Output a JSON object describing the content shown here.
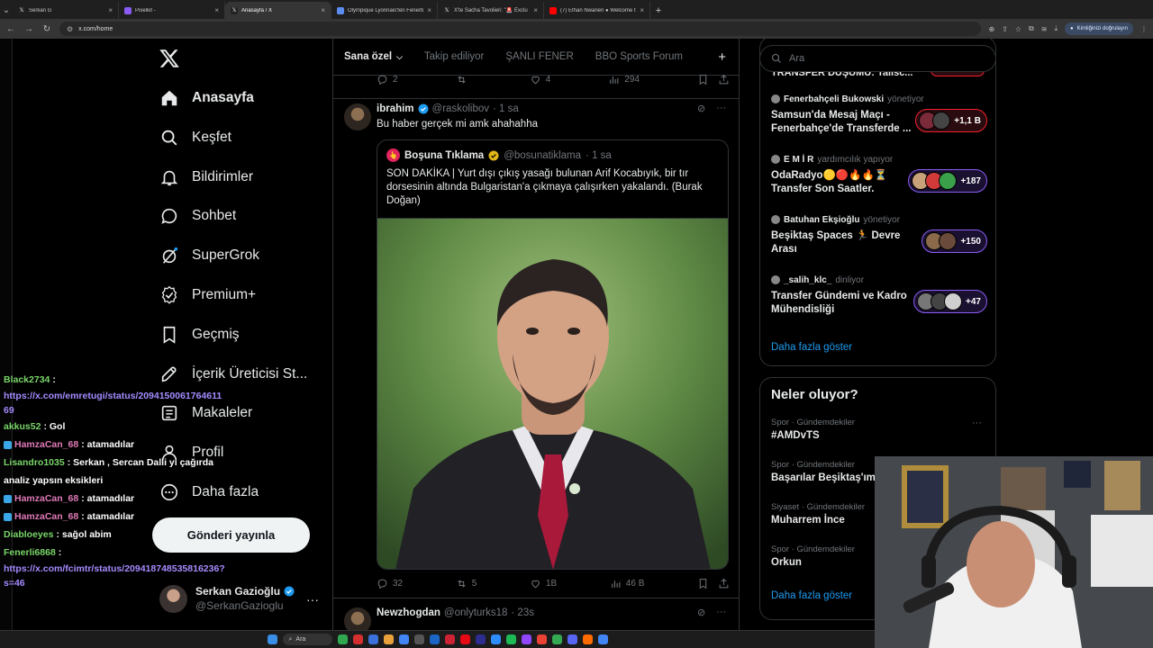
{
  "browser": {
    "tabs": [
      {
        "label": "Serkan G",
        "color": "#ffffff",
        "icon": "x-icon"
      },
      {
        "label": "Pixelkit -",
        "color": "#8a5cf5",
        "icon": "pixel-icon"
      },
      {
        "label": "Anasayfa / X",
        "color": "#ffffff",
        "icon": "x-icon",
        "active": true
      },
      {
        "label": "Olympique Lyonnais'ten Fenerb",
        "color": "#5b8def",
        "icon": "tf-icon"
      },
      {
        "label": "X'te Sacha Tavolieri: \"🚨 Exclu",
        "color": "#ffffff",
        "icon": "x-icon"
      },
      {
        "label": "(7) Ethan Nwaneri ● Welcome t",
        "color": "#ff0000",
        "icon": "youtube-icon"
      }
    ],
    "url": "x.com/home",
    "verify_label": "Kimliğinizi doğrulayın"
  },
  "sidebar": {
    "items": [
      {
        "label": "Anasayfa",
        "icon": "home-icon"
      },
      {
        "label": "Keşfet",
        "icon": "search-icon"
      },
      {
        "label": "Bildirimler",
        "icon": "bell-icon"
      },
      {
        "label": "Sohbet",
        "icon": "chat-icon"
      },
      {
        "label": "SuperGrok",
        "icon": "grok-icon"
      },
      {
        "label": "Premium+",
        "icon": "premium-icon"
      },
      {
        "label": "Geçmiş",
        "icon": "bookmark-icon"
      },
      {
        "label": "İçerik Üreticisi St...",
        "icon": "rocket-icon"
      },
      {
        "label": "Makaleler",
        "icon": "article-icon"
      },
      {
        "label": "Profil",
        "icon": "profile-icon"
      },
      {
        "label": "Daha fazla",
        "icon": "more-icon"
      }
    ],
    "post_button": "Gönderi yayınla",
    "account": {
      "name": "Serkan Gazioğlu",
      "handle": "@SerkanGazioglu"
    }
  },
  "timeline": {
    "tabs": [
      "Sana özel",
      "Takip ediliyor",
      "ŞANLI FENER",
      "BBO Sports Forum"
    ],
    "prev_stats": {
      "replies": "2",
      "reposts": "",
      "likes": "4",
      "views": "294"
    },
    "tweet": {
      "name": "ibrahim",
      "handle": "@raskolibov",
      "time": "· 1 sa",
      "text": "Bu haber gerçek mi amk ahahahha",
      "quote": {
        "name": "Boşuna Tıklama",
        "handle": "@bosunatiklama",
        "time": "· 1 sa",
        "text": "SON DAKİKA | Yurt dışı çıkış yasağı bulunan Arif Kocabıyık, bir tır dorsesinin altında Bulgaristan'a çıkmaya çalışırken yakalandı. (Burak Doğan)"
      },
      "stats": {
        "replies": "32",
        "reposts": "5",
        "likes": "1B",
        "views": "46 B"
      }
    },
    "next": {
      "name": "Newzhogdan",
      "handle": "@onlyturks18",
      "time": "· 23s"
    }
  },
  "right": {
    "search_placeholder": "Ara",
    "clipped_title": "TRANSFER DUŞUMU: Talısc...",
    "spaces": [
      {
        "host": "Fenerbahçeli Bukowski",
        "role": "yönetiyor",
        "title": "Samsun'da Mesaj Maçı - Fenerbahçe'de Transferde ...",
        "count": "+1,1 B",
        "style": "red"
      },
      {
        "host": "E M İ R",
        "role": "yardımcılık yapıyor",
        "title": "OdaRadyo🟡🔴🔥🔥⏳ Transfer Son Saatler.",
        "count": "+187",
        "style": "purple"
      },
      {
        "host": "Batuhan Ekşioğlu",
        "role": "yönetiyor",
        "title": "Beşiktaş Spaces 🏃 Devre Arası",
        "count": "+150",
        "style": "purple"
      },
      {
        "host": "_salih_klc_",
        "role": "dinliyor",
        "title": "Transfer Gündemi ve Kadro Mühendisliği",
        "count": "+47",
        "style": "purple"
      }
    ],
    "spaces_more": "Daha fazla göster",
    "trends_title": "Neler oluyor?",
    "trends": [
      {
        "category": "Spor · Gündemdekiler",
        "name": "#AMDvTS"
      },
      {
        "category": "Spor · Gündemdekiler",
        "name": "Başarılar Beşiktaş'ım"
      },
      {
        "category": "Siyaset · Gündemdekiler",
        "name": "Muharrem İnce"
      },
      {
        "category": "Spor · Gündemdekiler",
        "name": "Orkun"
      }
    ],
    "trends_more": "Daha fazla göster"
  },
  "chat": [
    {
      "user": "Black2734",
      "text": ":",
      "link": "https://x.com/emretugi/status/2094150061764​61​169"
    },
    {
      "user": "akkus52",
      "text": ": Gol"
    },
    {
      "user": "HamzaCan_68",
      "text": ": atamadılar",
      "badge": true
    },
    {
      "user": "Lisandro1035",
      "text": ": Serkan , Sercan Dalli yı çağırda analiz yapsın eksikleri"
    },
    {
      "user": "HamzaCan_68",
      "text": ": atamadılar",
      "badge": true
    },
    {
      "user": "HamzaCan_68",
      "text": ": atamadılar",
      "badge": true
    },
    {
      "user": "Diabloeyes",
      "text": ": sağol abim"
    },
    {
      "user": "Fenerli6868",
      "text": ":",
      "link": "https://x.com/fcimtr/status/20941874853581623​6?s=46"
    }
  ],
  "taskbar": {
    "search": "Ara"
  },
  "colors": {
    "accent": "#1d9bf0",
    "bg": "#000000",
    "border": "#2f3336",
    "muted": "#71767b"
  }
}
